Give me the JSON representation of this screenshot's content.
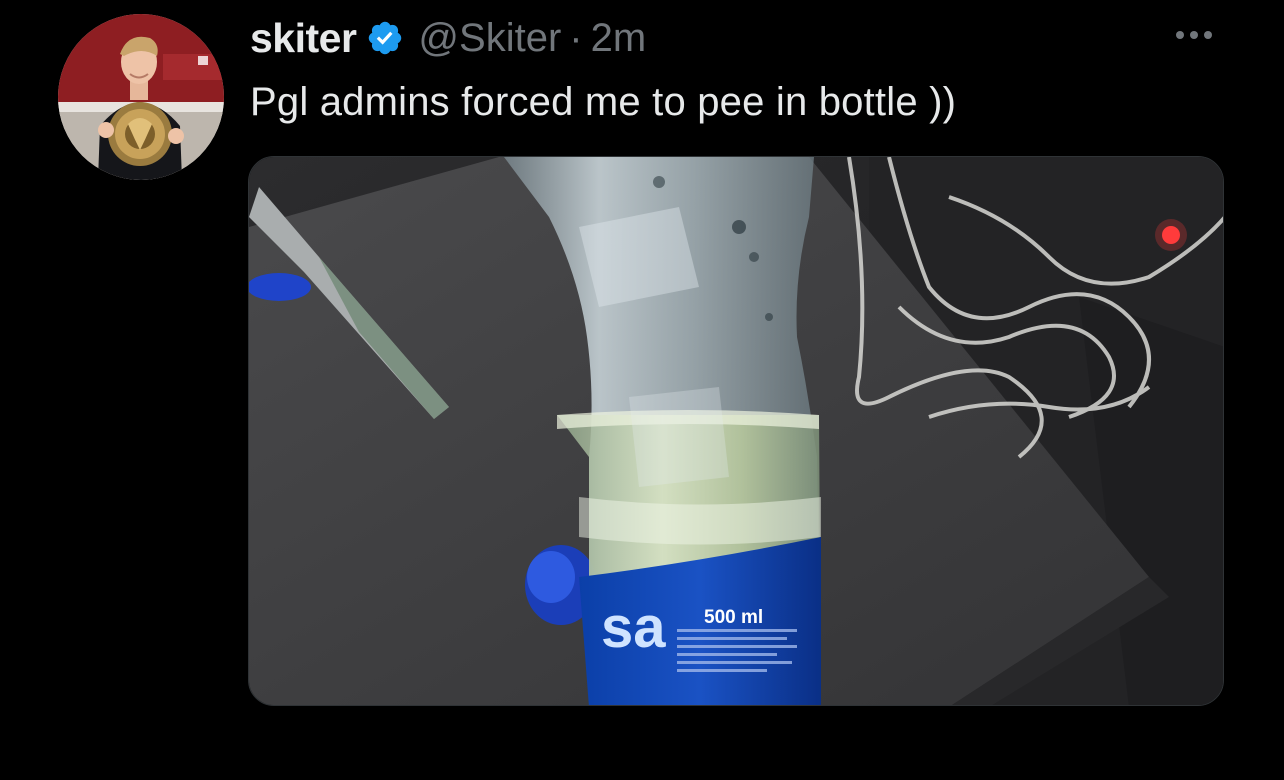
{
  "tweet": {
    "display_name": "skiter",
    "handle": "@Skiter",
    "separator": "·",
    "timestamp": "2m",
    "text": "Pgl admins forced me to pee in bottle ))",
    "verified": true,
    "more_icon": "more-horizontal-icon"
  },
  "media": {
    "label_volume": "500 ml",
    "brand_fragment": "sa"
  },
  "colors": {
    "background": "#000000",
    "primary_text": "#e7e9ea",
    "secondary_text": "#71767b",
    "verified_blue": "#1d9bf0"
  }
}
